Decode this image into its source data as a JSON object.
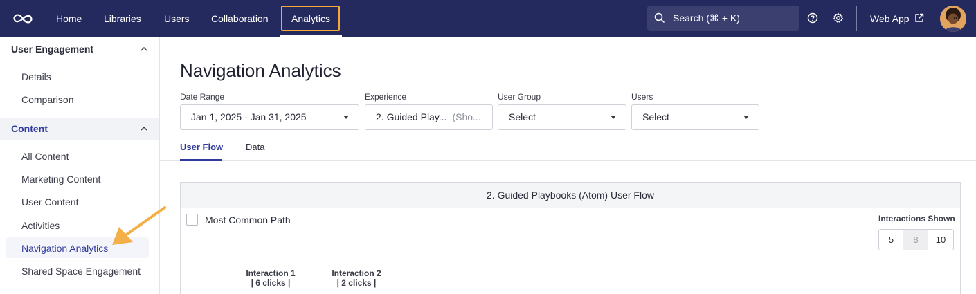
{
  "topbar": {
    "nav": [
      "Home",
      "Libraries",
      "Users",
      "Collaboration",
      "Analytics"
    ],
    "active_nav": "Analytics",
    "search_placeholder": "Search (⌘ + K)",
    "web_app_label": "Web App",
    "icons": [
      "logo-icon",
      "search-icon",
      "help-icon",
      "gear-icon",
      "external-link-icon"
    ]
  },
  "sidebar": {
    "sections": [
      {
        "title": "User Engagement",
        "expanded": true,
        "items": [
          "Details",
          "Comparison"
        ]
      },
      {
        "title": "Content",
        "expanded": true,
        "items": [
          "All Content",
          "Marketing Content",
          "User Content",
          "Activities",
          "Navigation Analytics",
          "Shared Space Engagement"
        ]
      }
    ],
    "active_item": "Navigation Analytics"
  },
  "main": {
    "title": "Navigation Analytics",
    "filters": {
      "date_range": {
        "label": "Date Range",
        "value": "Jan 1, 2025 - Jan 31, 2025"
      },
      "experience": {
        "label": "Experience",
        "value": "2. Guided Play...",
        "hint": "(Sho..."
      },
      "user_group": {
        "label": "User Group",
        "value": "Select"
      },
      "users": {
        "label": "Users",
        "value": "Select"
      }
    },
    "tabs": [
      "User Flow",
      "Data"
    ],
    "active_tab": "User Flow",
    "panel": {
      "title": "2. Guided Playbooks (Atom) User Flow",
      "checkbox_label": "Most Common Path",
      "interactions_shown_label": "Interactions Shown",
      "interaction_options": [
        "5",
        "8",
        "10"
      ],
      "interactions": [
        {
          "title": "Interaction 1",
          "clicks": "| 6 clicks |"
        },
        {
          "title": "Interaction 2",
          "clicks": "| 2 clicks |"
        }
      ]
    }
  },
  "colors": {
    "topbar": "#252a5e",
    "accent": "#2f3a9c",
    "highlight": "#f4a73a"
  }
}
